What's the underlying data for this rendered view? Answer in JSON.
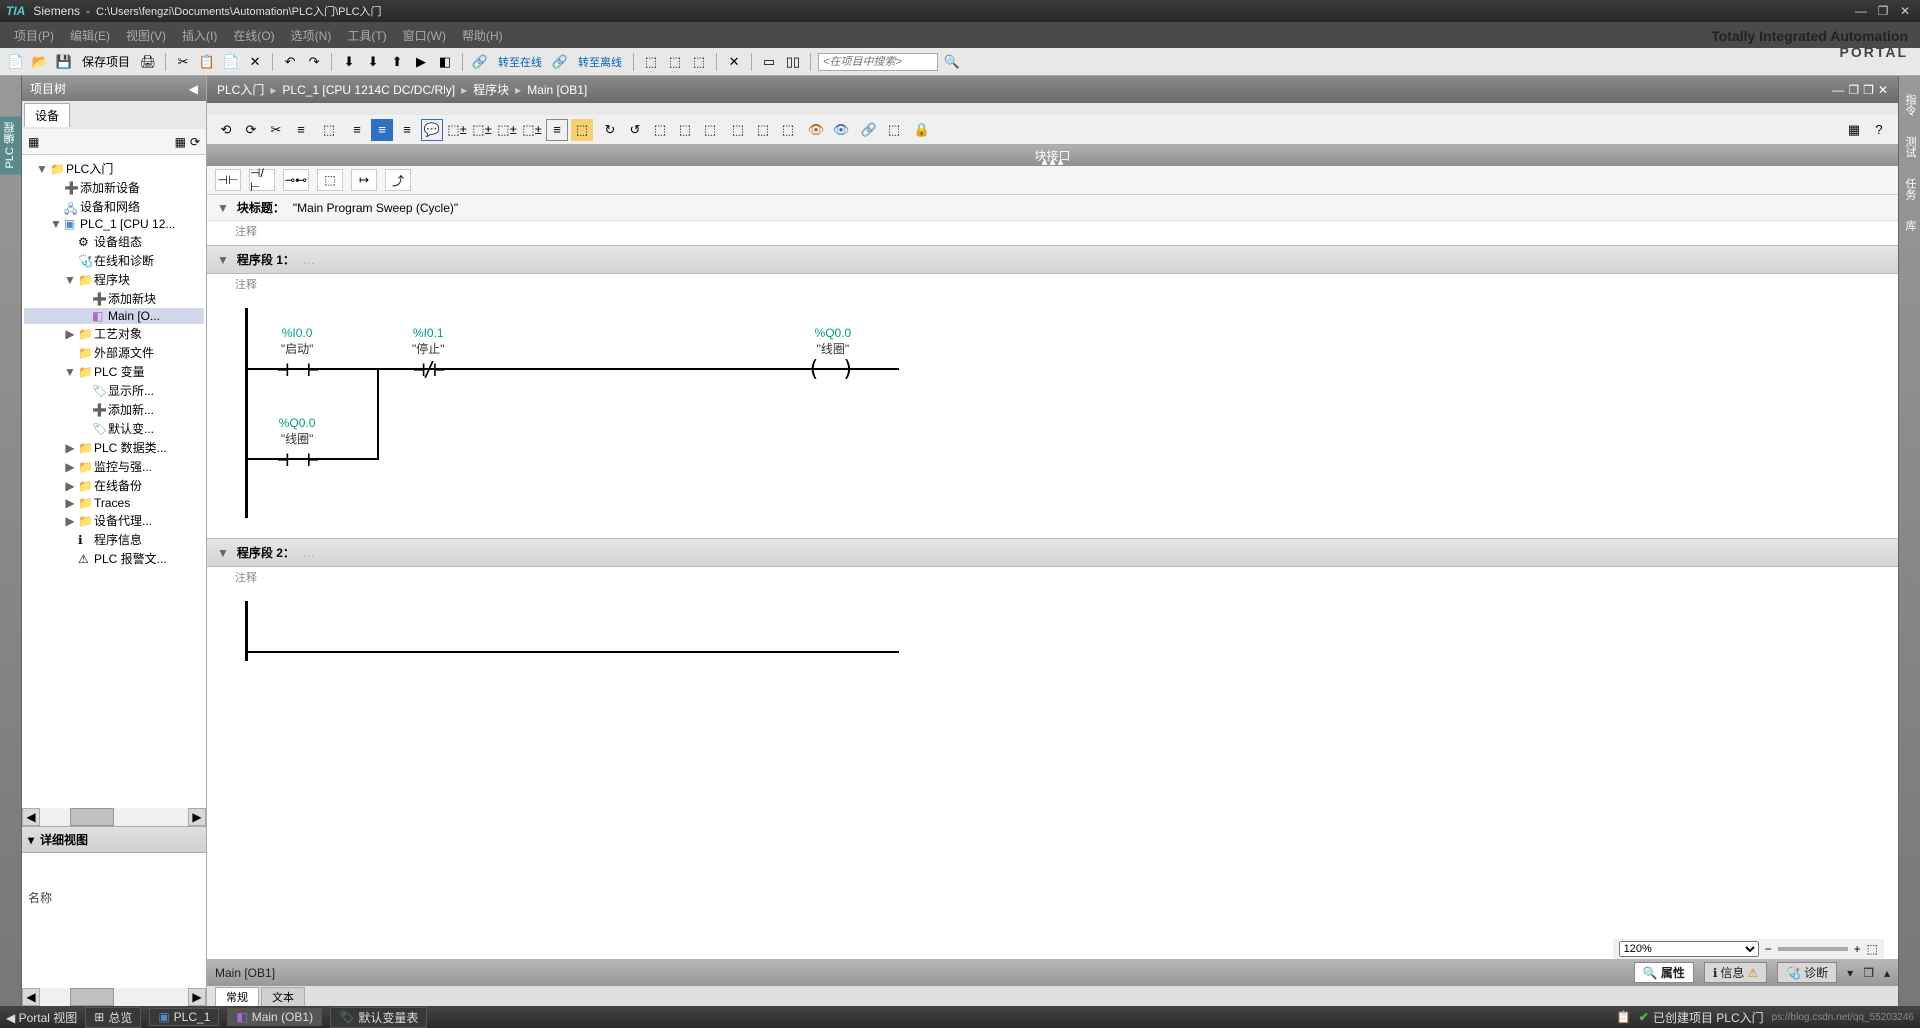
{
  "title": {
    "app": "Siemens",
    "sep": "-",
    "path": "C:\\Users\\fengzi\\Documents\\Automation\\PLC入门\\PLC入门"
  },
  "menus": [
    "项目(P)",
    "编辑(E)",
    "视图(V)",
    "插入(I)",
    "在线(O)",
    "选项(N)",
    "工具(T)",
    "窗口(W)",
    "帮助(H)"
  ],
  "branding": {
    "tia": "Totally Integrated Automation",
    "portal": "PORTAL"
  },
  "main_toolbar": {
    "save_label": "保存项目",
    "go_online": "转至在线",
    "go_offline": "转至离线",
    "search_placeholder": "<在项目中搜索>"
  },
  "left_vtabs": [
    "PLC 编程"
  ],
  "project_tree": {
    "title": "项目树",
    "tab": "设备",
    "root": "PLC入门",
    "items": [
      "添加新设备",
      "设备和网络",
      "PLC_1 [CPU 12...",
      "设备组态",
      "在线和诊断",
      "程序块",
      "添加新块",
      "Main [O...",
      "工艺对象",
      "外部源文件",
      "PLC 变量",
      "显示所...",
      "添加新...",
      "默认变...",
      "PLC 数据类...",
      "监控与强...",
      "在线备份",
      "Traces",
      "设备代理...",
      "程序信息",
      "PLC 报警文..."
    ]
  },
  "detail_view": {
    "title": "详细视图",
    "col_name": "名称"
  },
  "breadcrumb": [
    "PLC入门",
    "PLC_1 [CPU 1214C DC/DC/Rly]",
    "程序块",
    "Main [OB1]"
  ],
  "interface_label": "块接口",
  "block_title": {
    "label": "块标题：",
    "value": "\"Main Program Sweep (Cycle)\"",
    "comment": "注释"
  },
  "networks": [
    {
      "label": "程序段 1：",
      "comment": "注释",
      "elements": {
        "i0": {
          "addr": "%I0.0",
          "name": "\"启动\""
        },
        "i1": {
          "addr": "%I0.1",
          "name": "\"停止\""
        },
        "q0": {
          "addr": "%Q0.0",
          "name": "\"线圈\""
        },
        "q0b": {
          "addr": "%Q0.0",
          "name": "\"线圈\""
        }
      }
    },
    {
      "label": "程序段 2：",
      "comment": "注释"
    }
  ],
  "zoom": "120%",
  "props_bar": {
    "current": "Main [OB1]",
    "tabs": [
      "属性",
      "信息",
      "诊断"
    ],
    "sub_tabs": [
      "常规",
      "文本"
    ]
  },
  "right_vtabs": [
    "指令",
    "测试",
    "任务",
    "库"
  ],
  "status": {
    "portal": "Portal 视图",
    "tabs": [
      "总览",
      "PLC_1",
      "Main (OB1)",
      "默认变量表"
    ],
    "msg": "已创建项目 PLC入门",
    "watermark": "ps://blog.csdn.net/qq_55203246"
  }
}
